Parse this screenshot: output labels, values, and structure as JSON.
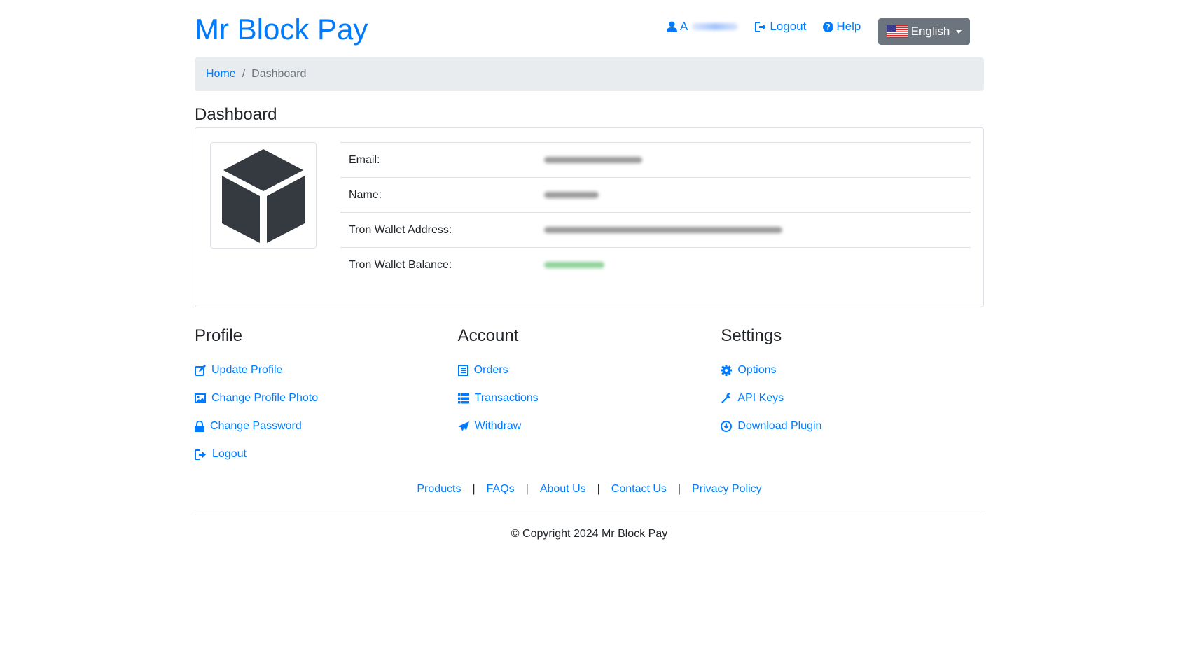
{
  "brand": "Mr Block Pay",
  "top_nav": {
    "user_initial": "A",
    "logout": "Logout",
    "help": "Help",
    "language": "English"
  },
  "breadcrumb": {
    "home": "Home",
    "separator": "/",
    "current": "Dashboard"
  },
  "dashboard": {
    "title": "Dashboard",
    "rows": [
      {
        "label": "Email:"
      },
      {
        "label": "Name:"
      },
      {
        "label": "Tron Wallet Address:"
      },
      {
        "label": "Tron Wallet Balance:"
      }
    ]
  },
  "sections": {
    "profile": {
      "title": "Profile",
      "links": [
        "Update Profile",
        "Change Profile Photo",
        "Change Password",
        "Logout"
      ]
    },
    "account": {
      "title": "Account",
      "links": [
        "Orders",
        "Transactions",
        "Withdraw"
      ]
    },
    "settings": {
      "title": "Settings",
      "links": [
        "Options",
        "API Keys",
        "Download Plugin"
      ]
    }
  },
  "footer": {
    "links": [
      "Products",
      "FAQs",
      "About Us",
      "Contact Us",
      "Privacy Policy"
    ],
    "separator": "|",
    "copyright": "© Copyright 2024 Mr Block Pay"
  },
  "colors": {
    "link": "#007bff",
    "lang_button": "#6c757d",
    "breadcrumb_bg": "#e9ecef",
    "cube": "#343a40"
  },
  "icons": {
    "user": "user-icon",
    "logout": "sign-out-icon",
    "help": "question-circle-icon",
    "flag": "us-flag-icon",
    "avatar": "cube-icon",
    "update_profile": "edit-icon",
    "change_photo": "image-icon",
    "change_password": "lock-icon",
    "orders": "list-alt-icon",
    "transactions": "list-icon",
    "withdraw": "paper-plane-icon",
    "options": "gear-icon",
    "api_keys": "wrench-icon",
    "download_plugin": "download-circle-icon"
  }
}
